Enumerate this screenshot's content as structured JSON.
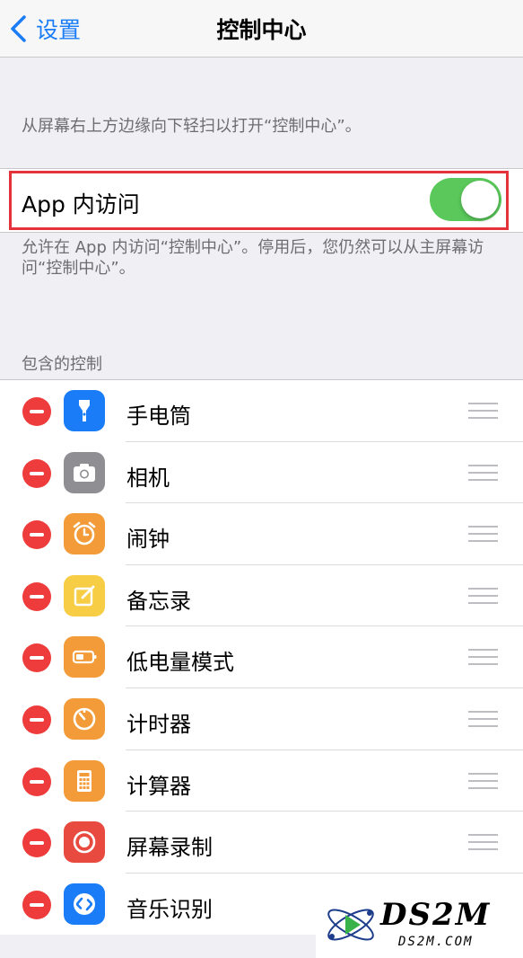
{
  "navbar": {
    "back_label": "设置",
    "title": "控制中心"
  },
  "swipe_hint": "从屏幕右上方边缘向下轻扫以打开“控制中心”。",
  "access_within_apps": {
    "label": "App 内访问",
    "enabled": true
  },
  "access_description": "允许在 App 内访问“控制中心”。停用后，您仍然可以从主屏幕访问“控制中心”。",
  "included_controls": {
    "header": "包含的控制",
    "items": [
      {
        "label": "手电筒",
        "icon": "flashlight-icon",
        "color": "#1a7cf6"
      },
      {
        "label": "相机",
        "icon": "camera-icon",
        "color": "#8e8e93"
      },
      {
        "label": "闹钟",
        "icon": "alarm-clock-icon",
        "color": "#f29b38"
      },
      {
        "label": "备忘录",
        "icon": "notes-icon",
        "color": "#f7cd46"
      },
      {
        "label": "低电量模式",
        "icon": "battery-icon",
        "color": "#f29b38"
      },
      {
        "label": "计时器",
        "icon": "timer-icon",
        "color": "#f29b38"
      },
      {
        "label": "计算器",
        "icon": "calculator-icon",
        "color": "#f29b38"
      },
      {
        "label": "屏幕录制",
        "icon": "screen-record-icon",
        "color": "#e84a3f"
      },
      {
        "label": "音乐识别",
        "icon": "shazam-icon",
        "color": "#1a7cf6"
      }
    ]
  },
  "watermark": {
    "brand": "DS2M",
    "domain": "DS2M.COM"
  }
}
